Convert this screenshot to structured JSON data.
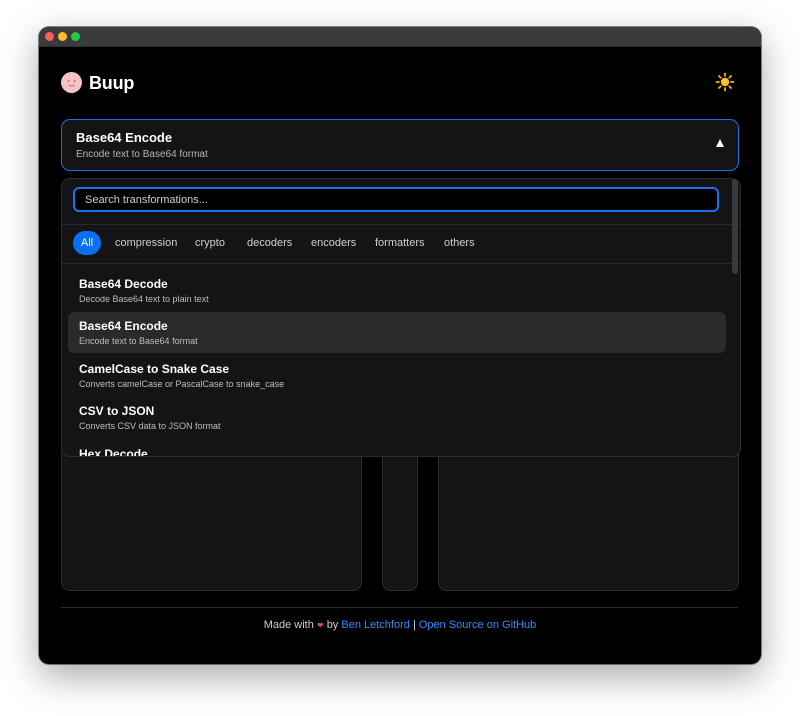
{
  "app": {
    "title": "Buup"
  },
  "header": {
    "theme_icon": "sun-icon"
  },
  "selector": {
    "title": "Base64 Encode",
    "description": "Encode text to Base64 format",
    "arrow_icon": "triangle-up-icon"
  },
  "dropdown": {
    "search_placeholder": "Search transformations...",
    "categories": [
      {
        "label": "All",
        "active": true
      },
      {
        "label": "compression"
      },
      {
        "label": "crypto"
      },
      {
        "label": "decoders"
      },
      {
        "label": "encoders"
      },
      {
        "label": "formatters"
      },
      {
        "label": "others"
      }
    ],
    "items": [
      {
        "title": "Base64 Decode",
        "description": "Decode Base64 text to plain text"
      },
      {
        "title": "Base64 Encode",
        "description": "Encode text to Base64 format",
        "selected": true
      },
      {
        "title": "CamelCase to Snake Case",
        "description": "Converts camelCase or PascalCase to snake_case"
      },
      {
        "title": "CSV to JSON",
        "description": "Converts CSV data to JSON format"
      },
      {
        "title": "Hex Decode",
        "description": ""
      }
    ]
  },
  "footer": {
    "made_with": "Made with",
    "heart": "❤",
    "by": "by",
    "author": "Ben Letchford",
    "separator": "|",
    "source": "Open Source on GitHub"
  },
  "colors": {
    "accent": "#1b6fe8",
    "chip_active": "#0a6ff0",
    "link": "#2f8cff",
    "heart": "#e84545"
  }
}
